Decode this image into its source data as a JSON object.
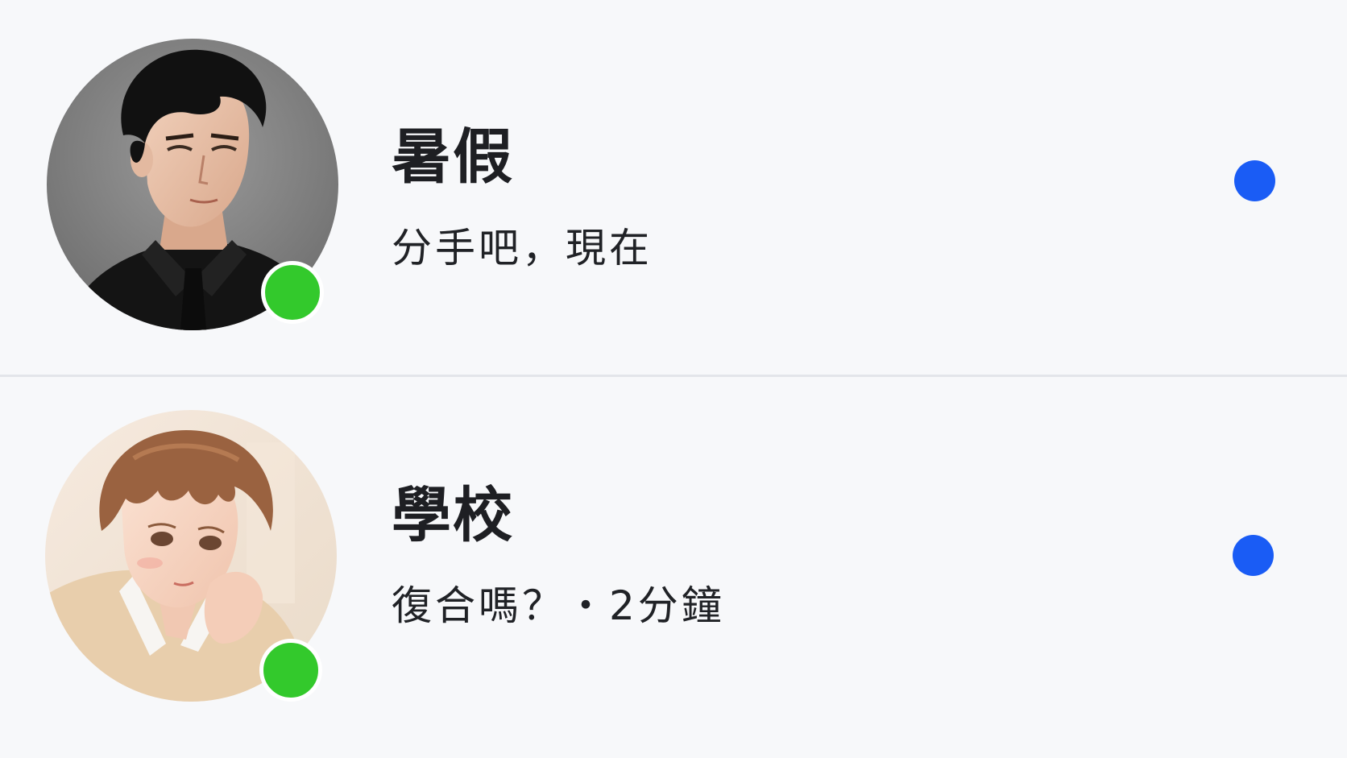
{
  "conversations": [
    {
      "name": "暑假",
      "preview": "分手吧，現在",
      "online": true,
      "unread": true
    },
    {
      "name": "學校",
      "preview": "復合嗎？・2分鐘",
      "online": true,
      "unread": true
    }
  ],
  "colors": {
    "background": "#f7f8fa",
    "online_indicator": "#33c92c",
    "unread_indicator": "#1a5cf5",
    "divider": "#e3e5ea",
    "text_primary": "#1e1f23"
  },
  "icons": {
    "online": "online-status-icon",
    "unread": "unread-indicator-icon"
  }
}
